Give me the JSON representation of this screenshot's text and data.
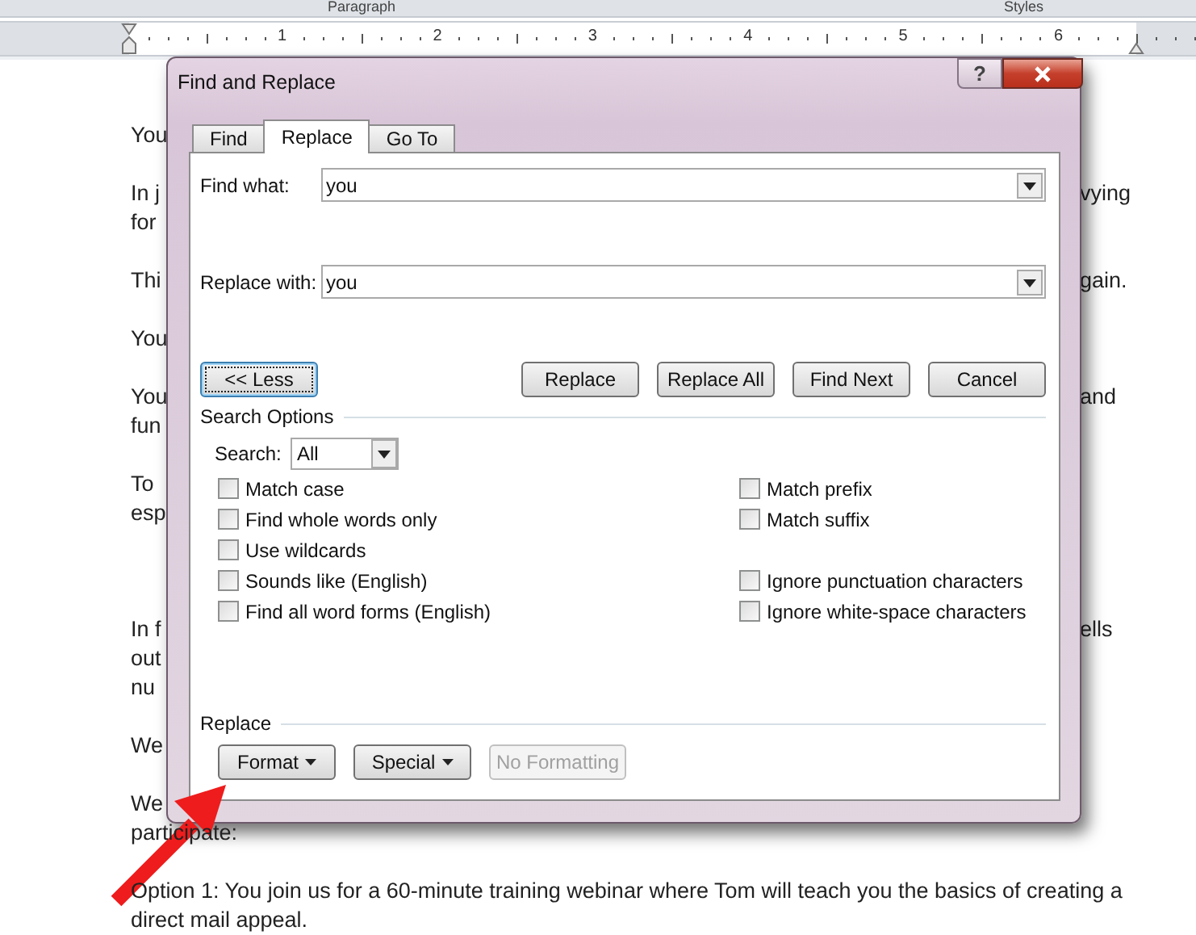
{
  "ribbon": {
    "groups": [
      "Paragraph",
      "Styles"
    ]
  },
  "ruler": {
    "numbers": [
      "1",
      "2",
      "3",
      "4",
      "5",
      "6"
    ]
  },
  "document": {
    "paragraphs": [
      {
        "lines": [
          {
            "left": "You"
          }
        ]
      },
      {
        "lines": [
          {
            "left": "In j",
            "right": "vying"
          },
          {
            "left": "for"
          }
        ]
      },
      {
        "lines": [
          {
            "left": "Thi",
            "right": "gain."
          }
        ]
      },
      {
        "lines": [
          {
            "left": "You"
          }
        ]
      },
      {
        "lines": [
          {
            "left": "You",
            "right": "and"
          },
          {
            "left": "fun"
          }
        ]
      },
      {
        "lines": [
          {
            "left": "To"
          },
          {
            "left": "esp"
          }
        ]
      },
      {
        "lines": [
          {
            "left": "In f",
            "right": "ells"
          },
          {
            "left": "out"
          },
          {
            "left": "nu"
          }
        ]
      },
      {
        "lines": [
          {
            "left": "We"
          }
        ]
      },
      {
        "lines": [
          {
            "left": "We"
          },
          {
            "left": "participate:"
          }
        ]
      },
      {
        "lines": [
          {
            "left": "Option 1: You join us for a 60-minute training webinar where Tom will teach you the basics of creating a"
          },
          {
            "left": "direct mail appeal."
          }
        ]
      }
    ]
  },
  "dialog": {
    "title": "Find and Replace",
    "help": "?",
    "tabs": [
      {
        "label": "Find",
        "selected": false
      },
      {
        "label": "Replace",
        "selected": true
      },
      {
        "label": "Go To",
        "selected": false
      }
    ],
    "find_what": {
      "label": "Find what:",
      "value": "you"
    },
    "replace_with": {
      "label": "Replace with:",
      "value": "you"
    },
    "less_button": "<< Less",
    "action_buttons": [
      "Replace",
      "Replace All",
      "Find Next",
      "Cancel"
    ],
    "search_options": {
      "heading": "Search Options",
      "search_label": "Search:",
      "search_value": "All",
      "left": [
        {
          "label": "Match case",
          "checked": false
        },
        {
          "label": "Find whole words only",
          "checked": false
        },
        {
          "label": "Use wildcards",
          "checked": false
        },
        {
          "label": "Sounds like (English)",
          "checked": false
        },
        {
          "label": "Find all word forms (English)",
          "checked": false
        }
      ],
      "right": [
        [
          {
            "label": "Match prefix",
            "checked": false
          },
          {
            "label": "Match suffix",
            "checked": false
          }
        ],
        [
          {
            "label": "Ignore punctuation characters",
            "checked": false
          },
          {
            "label": "Ignore white-space characters",
            "checked": false
          }
        ]
      ]
    },
    "replace_section": {
      "heading": "Replace",
      "buttons": [
        {
          "label": "Format",
          "menu": true,
          "disabled": false
        },
        {
          "label": "Special",
          "menu": true,
          "disabled": false
        },
        {
          "label": "No Formatting",
          "menu": false,
          "disabled": true
        }
      ]
    }
  }
}
